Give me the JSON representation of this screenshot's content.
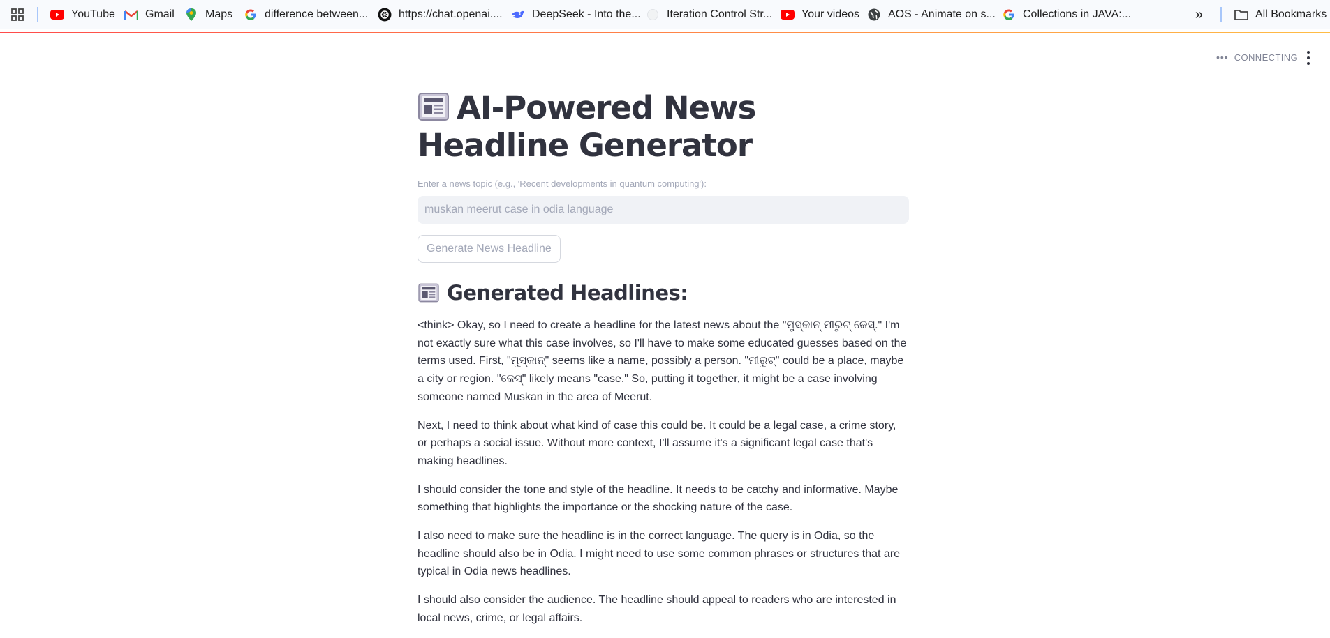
{
  "bookmarks_bar": {
    "apps_icon": "grid-icon",
    "items": [
      {
        "label": "YouTube",
        "icon": "youtube-icon"
      },
      {
        "label": "Gmail",
        "icon": "gmail-icon"
      },
      {
        "label": "Maps",
        "icon": "maps-icon"
      },
      {
        "label": "difference between...",
        "icon": "google-icon"
      },
      {
        "label": "https://chat.openai....",
        "icon": "openai-icon"
      },
      {
        "label": "DeepSeek - Into the...",
        "icon": "deepseek-icon"
      },
      {
        "label": "Iteration Control Str...",
        "icon": "page-icon"
      },
      {
        "label": "Your videos",
        "icon": "youtube-icon"
      },
      {
        "label": "AOS - Animate on s...",
        "icon": "globe-icon"
      },
      {
        "label": "Collections in JAVA:...",
        "icon": "google-icon"
      }
    ],
    "overflow_label": "»",
    "all_bookmarks_label": "All Bookmarks"
  },
  "header": {
    "status": "CONNECTING"
  },
  "main": {
    "title": "AI-Powered News Headline Generator",
    "title_icon": "newspaper-icon",
    "input_label": "Enter a news topic (e.g., 'Recent developments in quantum computing'):",
    "input_value": "muskan meerut case in odia language",
    "button_label": "Generate News Headline",
    "results_heading": "Generated Headlines:",
    "results_icon": "newspaper-icon",
    "paragraphs": [
      "<think> Okay, so I need to create a headline for the latest news about the \"ମୁସ୍କାନ୍ ମୀରୁଟ୍ କେସ୍.\" I'm not exactly sure what this case involves, so I'll have to make some educated guesses based on the terms used. First, \"ମୁସ୍କାନ୍\" seems like a name, possibly a person. \"ମୀରୁଟ୍\" could be a place, maybe a city or region. \"କେସ୍\" likely means \"case.\" So, putting it together, it might be a case involving someone named Muskan in the area of Meerut.",
      "Next, I need to think about what kind of case this could be. It could be a legal case, a crime story, or perhaps a social issue. Without more context, I'll assume it's a significant legal case that's making headlines.",
      "I should consider the tone and style of the headline. It needs to be catchy and informative. Maybe something that highlights the importance or the shocking nature of the case.",
      "I also need to make sure the headline is in the correct language. The query is in Odia, so the headline should also be in Odia. I might need to use some common phrases or structures that are typical in Odia news headlines.",
      "I should also consider the audience. The headline should appeal to readers who are interested in local news, crime, or legal affairs."
    ]
  }
}
